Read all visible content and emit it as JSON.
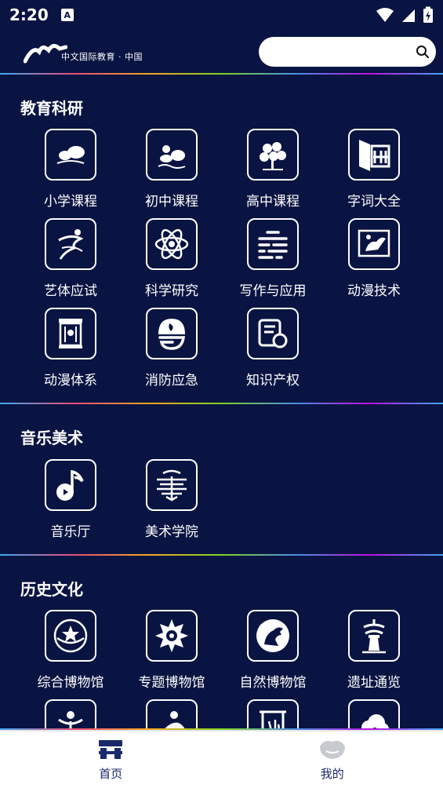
{
  "status": {
    "time": "2:20",
    "app_badge": "A"
  },
  "header": {
    "logo_text": "中文国际教育 · 中国",
    "search": {
      "value": "",
      "placeholder": ""
    }
  },
  "sections": [
    {
      "title": "教育科研",
      "items": [
        {
          "label": "小学课程",
          "icon": "chat-bubbles-icon"
        },
        {
          "label": "初中课程",
          "icon": "group-chat-icon"
        },
        {
          "label": "高中课程",
          "icon": "tree-icon"
        },
        {
          "label": "字词大全",
          "icon": "book-dictionary-icon"
        },
        {
          "label": "艺体应试",
          "icon": "dancer-icon"
        },
        {
          "label": "科学研究",
          "icon": "atom-icon"
        },
        {
          "label": "写作与应用",
          "icon": "text-lines-icon"
        },
        {
          "label": "动漫技术",
          "icon": "animation-frame-icon"
        },
        {
          "label": "动漫体系",
          "icon": "lantern-icon"
        },
        {
          "label": "消防应急",
          "icon": "fire-helmet-icon"
        },
        {
          "label": "知识产权",
          "icon": "certificate-icon"
        }
      ]
    },
    {
      "title": "音乐美术",
      "items": [
        {
          "label": "音乐厅",
          "icon": "music-note-icon"
        },
        {
          "label": "美术学院",
          "icon": "ornament-icon"
        }
      ]
    },
    {
      "title": "历史文化",
      "items": [
        {
          "label": "综合博物馆",
          "icon": "emblem-icon"
        },
        {
          "label": "专题博物馆",
          "icon": "snowflake-badge-icon"
        },
        {
          "label": "自然博物馆",
          "icon": "dinosaur-icon"
        },
        {
          "label": "遗址通览",
          "icon": "pagoda-icon"
        },
        {
          "label": "",
          "icon": "figure-icon"
        },
        {
          "label": "",
          "icon": "horse-rider-icon"
        },
        {
          "label": "",
          "icon": "calligraphy-icon"
        },
        {
          "label": "",
          "icon": "cloud-icon"
        }
      ]
    }
  ],
  "bottom_nav": [
    {
      "label": "首页",
      "icon": "home-icon",
      "active": true
    },
    {
      "label": "我的",
      "icon": "profile-icon",
      "active": false
    }
  ],
  "colors": {
    "background": "#0a1442",
    "nav_active": "#1a2a6c"
  }
}
